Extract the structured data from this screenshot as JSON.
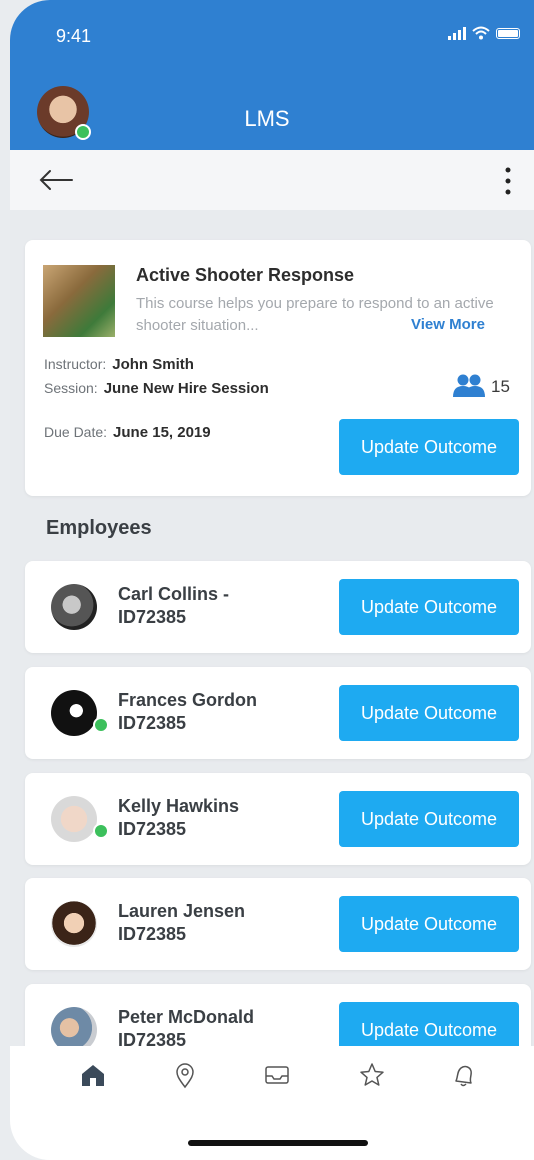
{
  "status": {
    "time": "9:41"
  },
  "header": {
    "title": "LMS"
  },
  "course": {
    "title": "Active Shooter Response",
    "description": "This course helps you prepare to respond to an active shooter situation...",
    "view_more": "View More",
    "instructor_label": "Instructor:",
    "instructor": "John Smith",
    "session_label": "Session:",
    "session": "June New Hire Session",
    "participants": "15",
    "due_label": "Due Date:",
    "due_date": "June 15, 2019",
    "update_label": "Update Outcome"
  },
  "employees_title": "Employees",
  "employees": [
    {
      "name": "Carl Collins -",
      "id": "ID72385",
      "button": "Update Outcome",
      "online": false
    },
    {
      "name": "Frances Gordon",
      "id": "ID72385",
      "button": "Update Outcome",
      "online": true
    },
    {
      "name": "Kelly Hawkins",
      "id": "ID72385",
      "button": "Update Outcome",
      "online": true
    },
    {
      "name": "Lauren Jensen",
      "id": "ID72385",
      "button": "Update Outcome",
      "online": false
    },
    {
      "name": "Peter McDonald",
      "id": "ID72385",
      "button": "Update Outcome",
      "online": false
    }
  ],
  "tabs": [
    "home-icon",
    "location-icon",
    "inbox-icon",
    "star-icon",
    "bell-icon"
  ],
  "colors": {
    "header": "#2f80d1",
    "button": "#1eaaf1",
    "online": "#3cc05c"
  }
}
